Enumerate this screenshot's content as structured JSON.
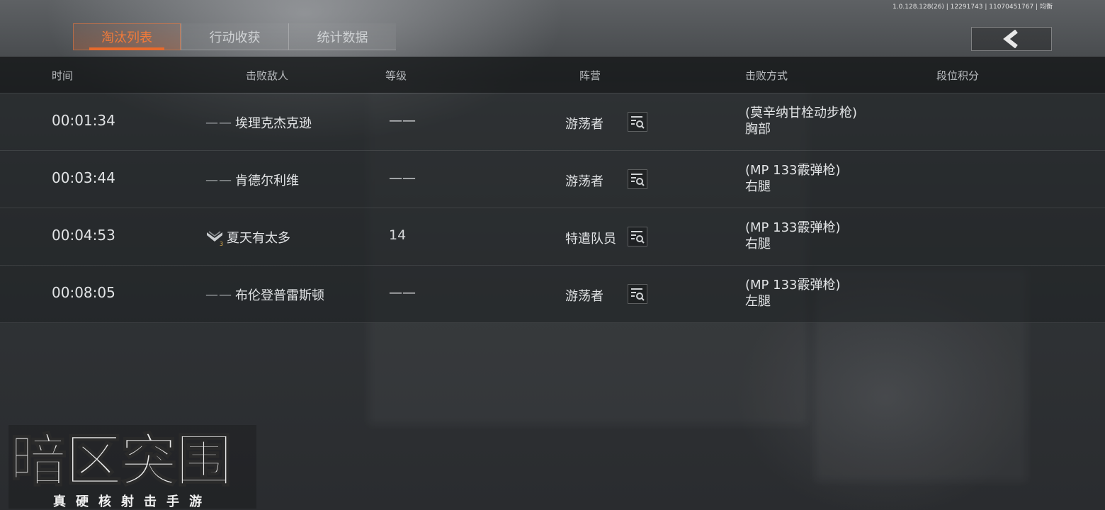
{
  "version_text": "1.0.128.128(26) | 12291743 | 11070451767 | 均衡",
  "tabs": [
    {
      "label": "淘汰列表",
      "active": true
    },
    {
      "label": "行动收获",
      "active": false
    },
    {
      "label": "统计数据",
      "active": false
    }
  ],
  "back_icon": "chevron-left-icon",
  "columns": {
    "time": "时间",
    "enemy": "击败敌人",
    "level": "等级",
    "faction": "阵营",
    "method": "击败方式",
    "rank_points": "段位积分"
  },
  "rows": [
    {
      "time": "00:01:34",
      "enemy_prefix": "——",
      "enemy": "埃理克杰克逊",
      "level": "——",
      "faction": "游荡者",
      "weapon": "(莫辛纳甘栓动步枪)",
      "body_part": "胸部",
      "rank_points": ""
    },
    {
      "time": "00:03:44",
      "enemy_prefix": "——",
      "enemy": "肯德尔利维",
      "level": "——",
      "faction": "游荡者",
      "weapon": "(MP 133霰弹枪)",
      "body_part": "右腿",
      "rank_points": ""
    },
    {
      "time": "00:04:53",
      "enemy_prefix": "",
      "enemy": "夏天有太多",
      "level": "14",
      "faction": "特遣队员",
      "weapon": "(MP 133霰弹枪)",
      "body_part": "右腿",
      "rank_points": "",
      "rank_badge": "3"
    },
    {
      "time": "00:08:05",
      "enemy_prefix": "——",
      "enemy": "布伦登普雷斯顿",
      "level": "——",
      "faction": "游荡者",
      "weapon": "(MP 133霰弹枪)",
      "body_part": "左腿",
      "rank_points": ""
    }
  ],
  "logo": {
    "title": "暗区突围",
    "subtitle": "真硬核射击手游"
  },
  "colors": {
    "accent": "#e86a2c",
    "text": "#e2e4e6",
    "header_bg": "#16181a"
  }
}
